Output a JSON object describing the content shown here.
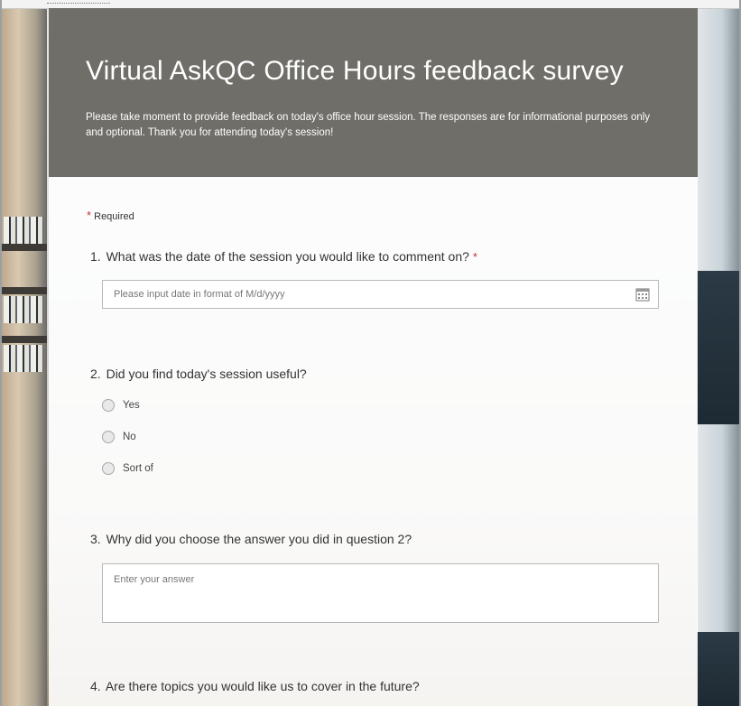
{
  "survey": {
    "title": "Virtual AskQC Office Hours feedback survey",
    "description": "Please take moment to provide feedback on today's office hour session. The responses are for informational purposes only and optional. Thank you for attending today's session!",
    "required_marker": "*",
    "required_label": "Required"
  },
  "questions": [
    {
      "number": "1.",
      "text": "What was the date of the session you would like to comment on?",
      "required_star": "*",
      "placeholder": "Please input date in format of M/d/yyyy",
      "icon": "calendar-icon"
    },
    {
      "number": "2.",
      "text": "Did you find today's session useful?",
      "options": [
        "Yes",
        "No",
        "Sort of"
      ]
    },
    {
      "number": "3.",
      "text": "Why did you choose the answer you did in question 2?",
      "placeholder": "Enter your answer"
    },
    {
      "number": "4.",
      "text": "Are there topics you would like us to cover in the future?"
    }
  ],
  "colors": {
    "header_bg": "#6f6e68",
    "required_star": "#c0382b"
  }
}
